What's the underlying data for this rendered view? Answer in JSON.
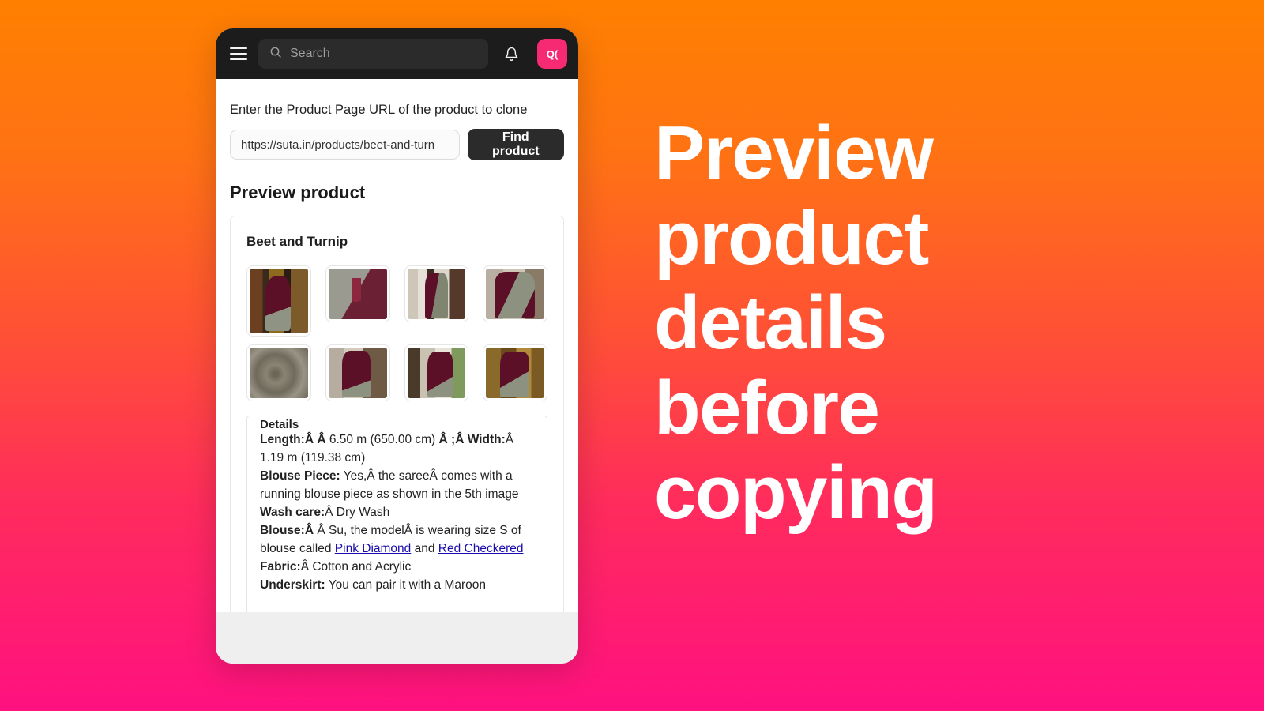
{
  "hero": {
    "headline": "Preview product details before copying"
  },
  "phone": {
    "header": {
      "menu_icon": "hamburger-menu-icon",
      "search": {
        "icon": "search-icon",
        "placeholder": "Search",
        "value": ""
      },
      "bell_icon": "notification-bell-icon",
      "avatar_label": "Q("
    },
    "form": {
      "url_label": "Enter the Product Page URL of the product to clone",
      "url_value": "https://suta.in/products/beet-and-turn",
      "url_placeholder": "https://",
      "find_button": "Find product"
    },
    "preview": {
      "section_title": "Preview product",
      "product_name": "Beet and Turnip",
      "thumbnails": [
        {
          "alt": "Model in maroon saree at doorway",
          "style": "p1",
          "size": "big",
          "selected": true
        },
        {
          "alt": "Close-up of olive and maroon fabric with tassels",
          "style": "p2",
          "size": "small",
          "selected": false
        },
        {
          "alt": "Model draping saree indoors",
          "style": "p3",
          "size": "small",
          "selected": false
        },
        {
          "alt": "Model holding olive pallu",
          "style": "p4",
          "size": "small",
          "selected": false
        },
        {
          "alt": "Swirled olive fabric texture",
          "style": "p5",
          "size": "small",
          "selected": false
        },
        {
          "alt": "Model adjusting hair in maroon saree",
          "style": "p6",
          "size": "small",
          "selected": false
        },
        {
          "alt": "Model by chair holding pallu",
          "style": "p7",
          "size": "small",
          "selected": false
        },
        {
          "alt": "Model in maroon saree near yellow door",
          "style": "p8",
          "size": "small",
          "selected": false
        }
      ],
      "details_heading": "Details",
      "details": [
        {
          "parts": [
            {
              "t": "b",
              "v": "Length:Â Â "
            },
            {
              "t": "text",
              "v": " 6.50 m (650.00 cm) "
            },
            {
              "t": "b",
              "v": "Â ;Â Width:"
            },
            {
              "t": "text",
              "v": "Â 1.19 m (119.38 cm)"
            }
          ]
        },
        {
          "parts": [
            {
              "t": "b",
              "v": "Blouse Piece:"
            },
            {
              "t": "text",
              "v": " Yes,Â the sareeÂ comes with a running blouse piece as shown in the 5th image"
            }
          ]
        },
        {
          "parts": [
            {
              "t": "b",
              "v": "Wash care:"
            },
            {
              "t": "text",
              "v": "Â Dry Wash"
            }
          ]
        },
        {
          "parts": [
            {
              "t": "b",
              "v": "Blouse:Â"
            },
            {
              "t": "text",
              "v": " Â Su, the modelÂ is wearing size S of blouse called "
            },
            {
              "t": "link",
              "v": "Pink Diamond"
            },
            {
              "t": "text",
              "v": " and "
            },
            {
              "t": "link",
              "v": "Red Checkered"
            }
          ]
        },
        {
          "parts": [
            {
              "t": "b",
              "v": "Fabric:"
            },
            {
              "t": "text",
              "v": "Â Cotton and Acrylic"
            }
          ]
        },
        {
          "parts": [
            {
              "t": "b",
              "v": "Underskirt:"
            },
            {
              "t": "text",
              "v": " You can pair it with a Maroon"
            }
          ]
        }
      ]
    }
  },
  "colors": {
    "gradient_top": "#FF8000",
    "gradient_bottom": "#FF1180",
    "header_bg": "#1C1C1C",
    "avatar_bg": "#F62A72",
    "button_bg": "#2B2B2B",
    "link": "#1A0DAB"
  }
}
